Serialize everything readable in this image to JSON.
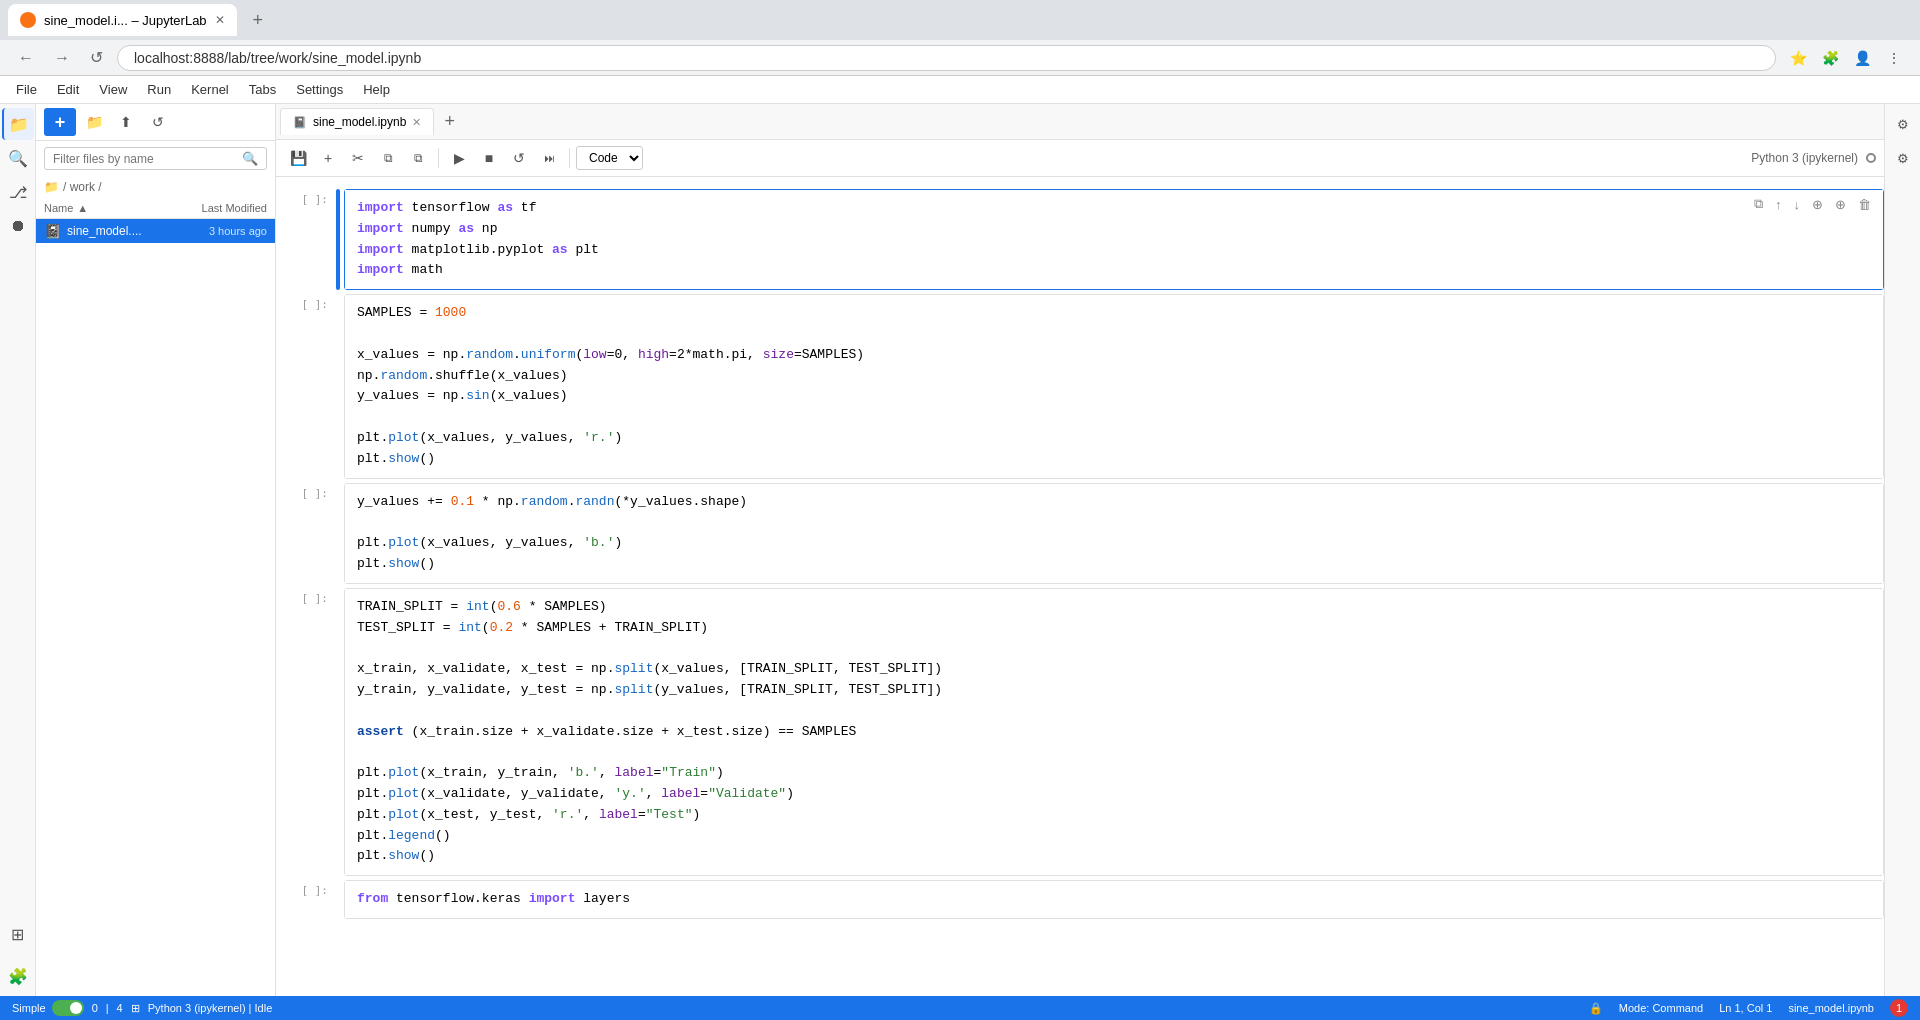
{
  "browser": {
    "tab_title": "sine_model.i... – JupyterLab",
    "url": "localhost:8888/lab/tree/work/sine_model.ipynb",
    "new_tab_label": "+"
  },
  "menu": {
    "items": [
      "File",
      "Edit",
      "View",
      "Run",
      "Kernel",
      "Tabs",
      "Settings",
      "Help"
    ]
  },
  "sidebar": {
    "icons": [
      "folder",
      "search",
      "git",
      "extensions",
      "command-palette"
    ]
  },
  "file_panel": {
    "breadcrumb": "/ work /",
    "search_placeholder": "Filter files by name",
    "columns": {
      "name": "Name",
      "modified": "Last Modified"
    },
    "files": [
      {
        "name": "sine_model....",
        "modified": "3 hours ago",
        "icon": "notebook",
        "selected": true
      }
    ]
  },
  "notebook": {
    "tab_name": "sine_model.ipynb",
    "kernel": "Python 3 (ipykernel)",
    "cell_type": "Code",
    "cells": [
      {
        "label": "[ ]:",
        "active": true,
        "code_lines": [
          {
            "parts": [
              {
                "text": "import",
                "cls": "kw"
              },
              {
                "text": " tensorflow ",
                "cls": "var"
              },
              {
                "text": "as",
                "cls": "kw"
              },
              {
                "text": " tf",
                "cls": "var"
              }
            ]
          },
          {
            "parts": [
              {
                "text": "import",
                "cls": "kw"
              },
              {
                "text": " numpy ",
                "cls": "var"
              },
              {
                "text": "as",
                "cls": "kw"
              },
              {
                "text": " np",
                "cls": "var"
              }
            ]
          },
          {
            "parts": [
              {
                "text": "import",
                "cls": "kw"
              },
              {
                "text": " matplotlib.pyplot ",
                "cls": "var"
              },
              {
                "text": "as",
                "cls": "kw"
              },
              {
                "text": " plt",
                "cls": "var"
              }
            ]
          },
          {
            "parts": [
              {
                "text": "import",
                "cls": "kw"
              },
              {
                "text": " math",
                "cls": "var"
              }
            ]
          }
        ]
      },
      {
        "label": "[ ]:",
        "active": false,
        "code_lines": [
          {
            "parts": [
              {
                "text": "SAMPLES",
                "cls": "var"
              },
              {
                "text": " = ",
                "cls": "op"
              },
              {
                "text": "1000",
                "cls": "num"
              }
            ]
          },
          {
            "parts": []
          },
          {
            "parts": [
              {
                "text": "x_values",
                "cls": "var"
              },
              {
                "text": " = np.",
                "cls": "var"
              },
              {
                "text": "random",
                "cls": "fn"
              },
              {
                "text": ".",
                "cls": "var"
              },
              {
                "text": "uniform",
                "cls": "fn"
              },
              {
                "text": "(",
                "cls": "var"
              },
              {
                "text": "low",
                "cls": "param"
              },
              {
                "text": "=0, ",
                "cls": "var"
              },
              {
                "text": "high",
                "cls": "param"
              },
              {
                "text": "=2*math.pi, ",
                "cls": "var"
              },
              {
                "text": "size",
                "cls": "param"
              },
              {
                "text": "=SAMPLES)",
                "cls": "var"
              }
            ]
          },
          {
            "parts": [
              {
                "text": "np.",
                "cls": "var"
              },
              {
                "text": "random",
                "cls": "fn"
              },
              {
                "text": ".shuffle(x_values)",
                "cls": "var"
              }
            ]
          },
          {
            "parts": [
              {
                "text": "y_values",
                "cls": "var"
              },
              {
                "text": " = np.",
                "cls": "var"
              },
              {
                "text": "sin",
                "cls": "fn"
              },
              {
                "text": "(x_values)",
                "cls": "var"
              }
            ]
          },
          {
            "parts": []
          },
          {
            "parts": [
              {
                "text": "plt.",
                "cls": "var"
              },
              {
                "text": "plot",
                "cls": "fn"
              },
              {
                "text": "(x_values, y_values, ",
                "cls": "var"
              },
              {
                "text": "'r.'",
                "cls": "str"
              },
              {
                "text": ")",
                "cls": "var"
              }
            ]
          },
          {
            "parts": [
              {
                "text": "plt.",
                "cls": "var"
              },
              {
                "text": "show",
                "cls": "fn"
              },
              {
                "text": "()",
                "cls": "var"
              }
            ]
          }
        ]
      },
      {
        "label": "[ ]:",
        "active": false,
        "code_lines": [
          {
            "parts": [
              {
                "text": "y_values",
                "cls": "var"
              },
              {
                "text": " += ",
                "cls": "op"
              },
              {
                "text": "0.1",
                "cls": "num"
              },
              {
                "text": " * np.",
                "cls": "var"
              },
              {
                "text": "random",
                "cls": "fn"
              },
              {
                "text": ".",
                "cls": "var"
              },
              {
                "text": "randn",
                "cls": "fn"
              },
              {
                "text": "(*y_values.shape)",
                "cls": "var"
              }
            ]
          },
          {
            "parts": []
          },
          {
            "parts": [
              {
                "text": "plt.",
                "cls": "var"
              },
              {
                "text": "plot",
                "cls": "fn"
              },
              {
                "text": "(x_values, y_values, ",
                "cls": "var"
              },
              {
                "text": "'b.'",
                "cls": "str"
              },
              {
                "text": ")",
                "cls": "var"
              }
            ]
          },
          {
            "parts": [
              {
                "text": "plt.",
                "cls": "var"
              },
              {
                "text": "show",
                "cls": "fn"
              },
              {
                "text": "()",
                "cls": "var"
              }
            ]
          }
        ]
      },
      {
        "label": "[ ]:",
        "active": false,
        "code_lines": [
          {
            "parts": [
              {
                "text": "TRAIN_SPLIT",
                "cls": "var"
              },
              {
                "text": " = ",
                "cls": "op"
              },
              {
                "text": "int",
                "cls": "fn"
              },
              {
                "text": "(",
                "cls": "var"
              },
              {
                "text": "0.6",
                "cls": "num"
              },
              {
                "text": " * SAMPLES)",
                "cls": "var"
              }
            ]
          },
          {
            "parts": [
              {
                "text": "TEST_SPLIT",
                "cls": "var"
              },
              {
                "text": " = ",
                "cls": "op"
              },
              {
                "text": "int",
                "cls": "fn"
              },
              {
                "text": "(",
                "cls": "var"
              },
              {
                "text": "0.2",
                "cls": "num"
              },
              {
                "text": " * SAMPLES + TRAIN_SPLIT)",
                "cls": "var"
              }
            ]
          },
          {
            "parts": []
          },
          {
            "parts": [
              {
                "text": "x_train, x_validate, x_test",
                "cls": "var"
              },
              {
                "text": " = np.",
                "cls": "var"
              },
              {
                "text": "split",
                "cls": "fn"
              },
              {
                "text": "(x_values, [TRAIN_SPLIT, TEST_SPLIT])",
                "cls": "var"
              }
            ]
          },
          {
            "parts": [
              {
                "text": "y_train, y_validate, y_test",
                "cls": "var"
              },
              {
                "text": " = np.",
                "cls": "var"
              },
              {
                "text": "split",
                "cls": "fn"
              },
              {
                "text": "(y_values, [TRAIN_SPLIT, TEST_SPLIT])",
                "cls": "var"
              }
            ]
          },
          {
            "parts": []
          },
          {
            "parts": [
              {
                "text": "assert",
                "cls": "kw2"
              },
              {
                "text": " (x_train.size + x_validate.size + x_test.size) == SAMPLES",
                "cls": "var"
              }
            ]
          },
          {
            "parts": []
          },
          {
            "parts": [
              {
                "text": "plt.",
                "cls": "var"
              },
              {
                "text": "plot",
                "cls": "fn"
              },
              {
                "text": "(x_train, y_train, ",
                "cls": "var"
              },
              {
                "text": "'b.'",
                "cls": "str"
              },
              {
                "text": ", ",
                "cls": "var"
              },
              {
                "text": "label",
                "cls": "param"
              },
              {
                "text": "=",
                "cls": "op"
              },
              {
                "text": "\"Train\"",
                "cls": "str"
              },
              {
                "text": ")",
                "cls": "var"
              }
            ]
          },
          {
            "parts": [
              {
                "text": "plt.",
                "cls": "var"
              },
              {
                "text": "plot",
                "cls": "fn"
              },
              {
                "text": "(x_validate, y_validate, ",
                "cls": "var"
              },
              {
                "text": "'y.'",
                "cls": "str"
              },
              {
                "text": ", ",
                "cls": "var"
              },
              {
                "text": "label",
                "cls": "param"
              },
              {
                "text": "=",
                "cls": "op"
              },
              {
                "text": "\"Validate\"",
                "cls": "str"
              },
              {
                "text": ")",
                "cls": "var"
              }
            ]
          },
          {
            "parts": [
              {
                "text": "plt.",
                "cls": "var"
              },
              {
                "text": "plot",
                "cls": "fn"
              },
              {
                "text": "(x_test, y_test, ",
                "cls": "var"
              },
              {
                "text": "'r.'",
                "cls": "str"
              },
              {
                "text": ", ",
                "cls": "var"
              },
              {
                "text": "label",
                "cls": "param"
              },
              {
                "text": "=",
                "cls": "op"
              },
              {
                "text": "\"Test\"",
                "cls": "str"
              },
              {
                "text": ")",
                "cls": "var"
              }
            ]
          },
          {
            "parts": [
              {
                "text": "plt.",
                "cls": "var"
              },
              {
                "text": "legend",
                "cls": "fn"
              },
              {
                "text": "()",
                "cls": "var"
              }
            ]
          },
          {
            "parts": [
              {
                "text": "plt.",
                "cls": "var"
              },
              {
                "text": "show",
                "cls": "fn"
              },
              {
                "text": "()",
                "cls": "var"
              }
            ]
          }
        ]
      },
      {
        "label": "[ ]:",
        "active": false,
        "code_lines": [
          {
            "parts": [
              {
                "text": "from",
                "cls": "kw"
              },
              {
                "text": " tensorflow.keras ",
                "cls": "var"
              },
              {
                "text": "import",
                "cls": "kw"
              },
              {
                "text": " layers",
                "cls": "var"
              }
            ]
          }
        ]
      }
    ]
  },
  "status_bar": {
    "simple_label": "Simple",
    "mode": "Mode: Command",
    "position": "Ln 1, Col 1",
    "file": "sine_model.ipynb",
    "notifications": "1",
    "cell_count": "0",
    "kernel": "Python 3 (ipykernel) | Idle"
  },
  "toolbar_buttons": {
    "save": "💾",
    "add_cell": "+",
    "cut": "✂",
    "copy": "⧉",
    "paste": "⧉",
    "run": "▶",
    "stop": "■",
    "restart": "↺",
    "fast_forward": "⏭"
  }
}
